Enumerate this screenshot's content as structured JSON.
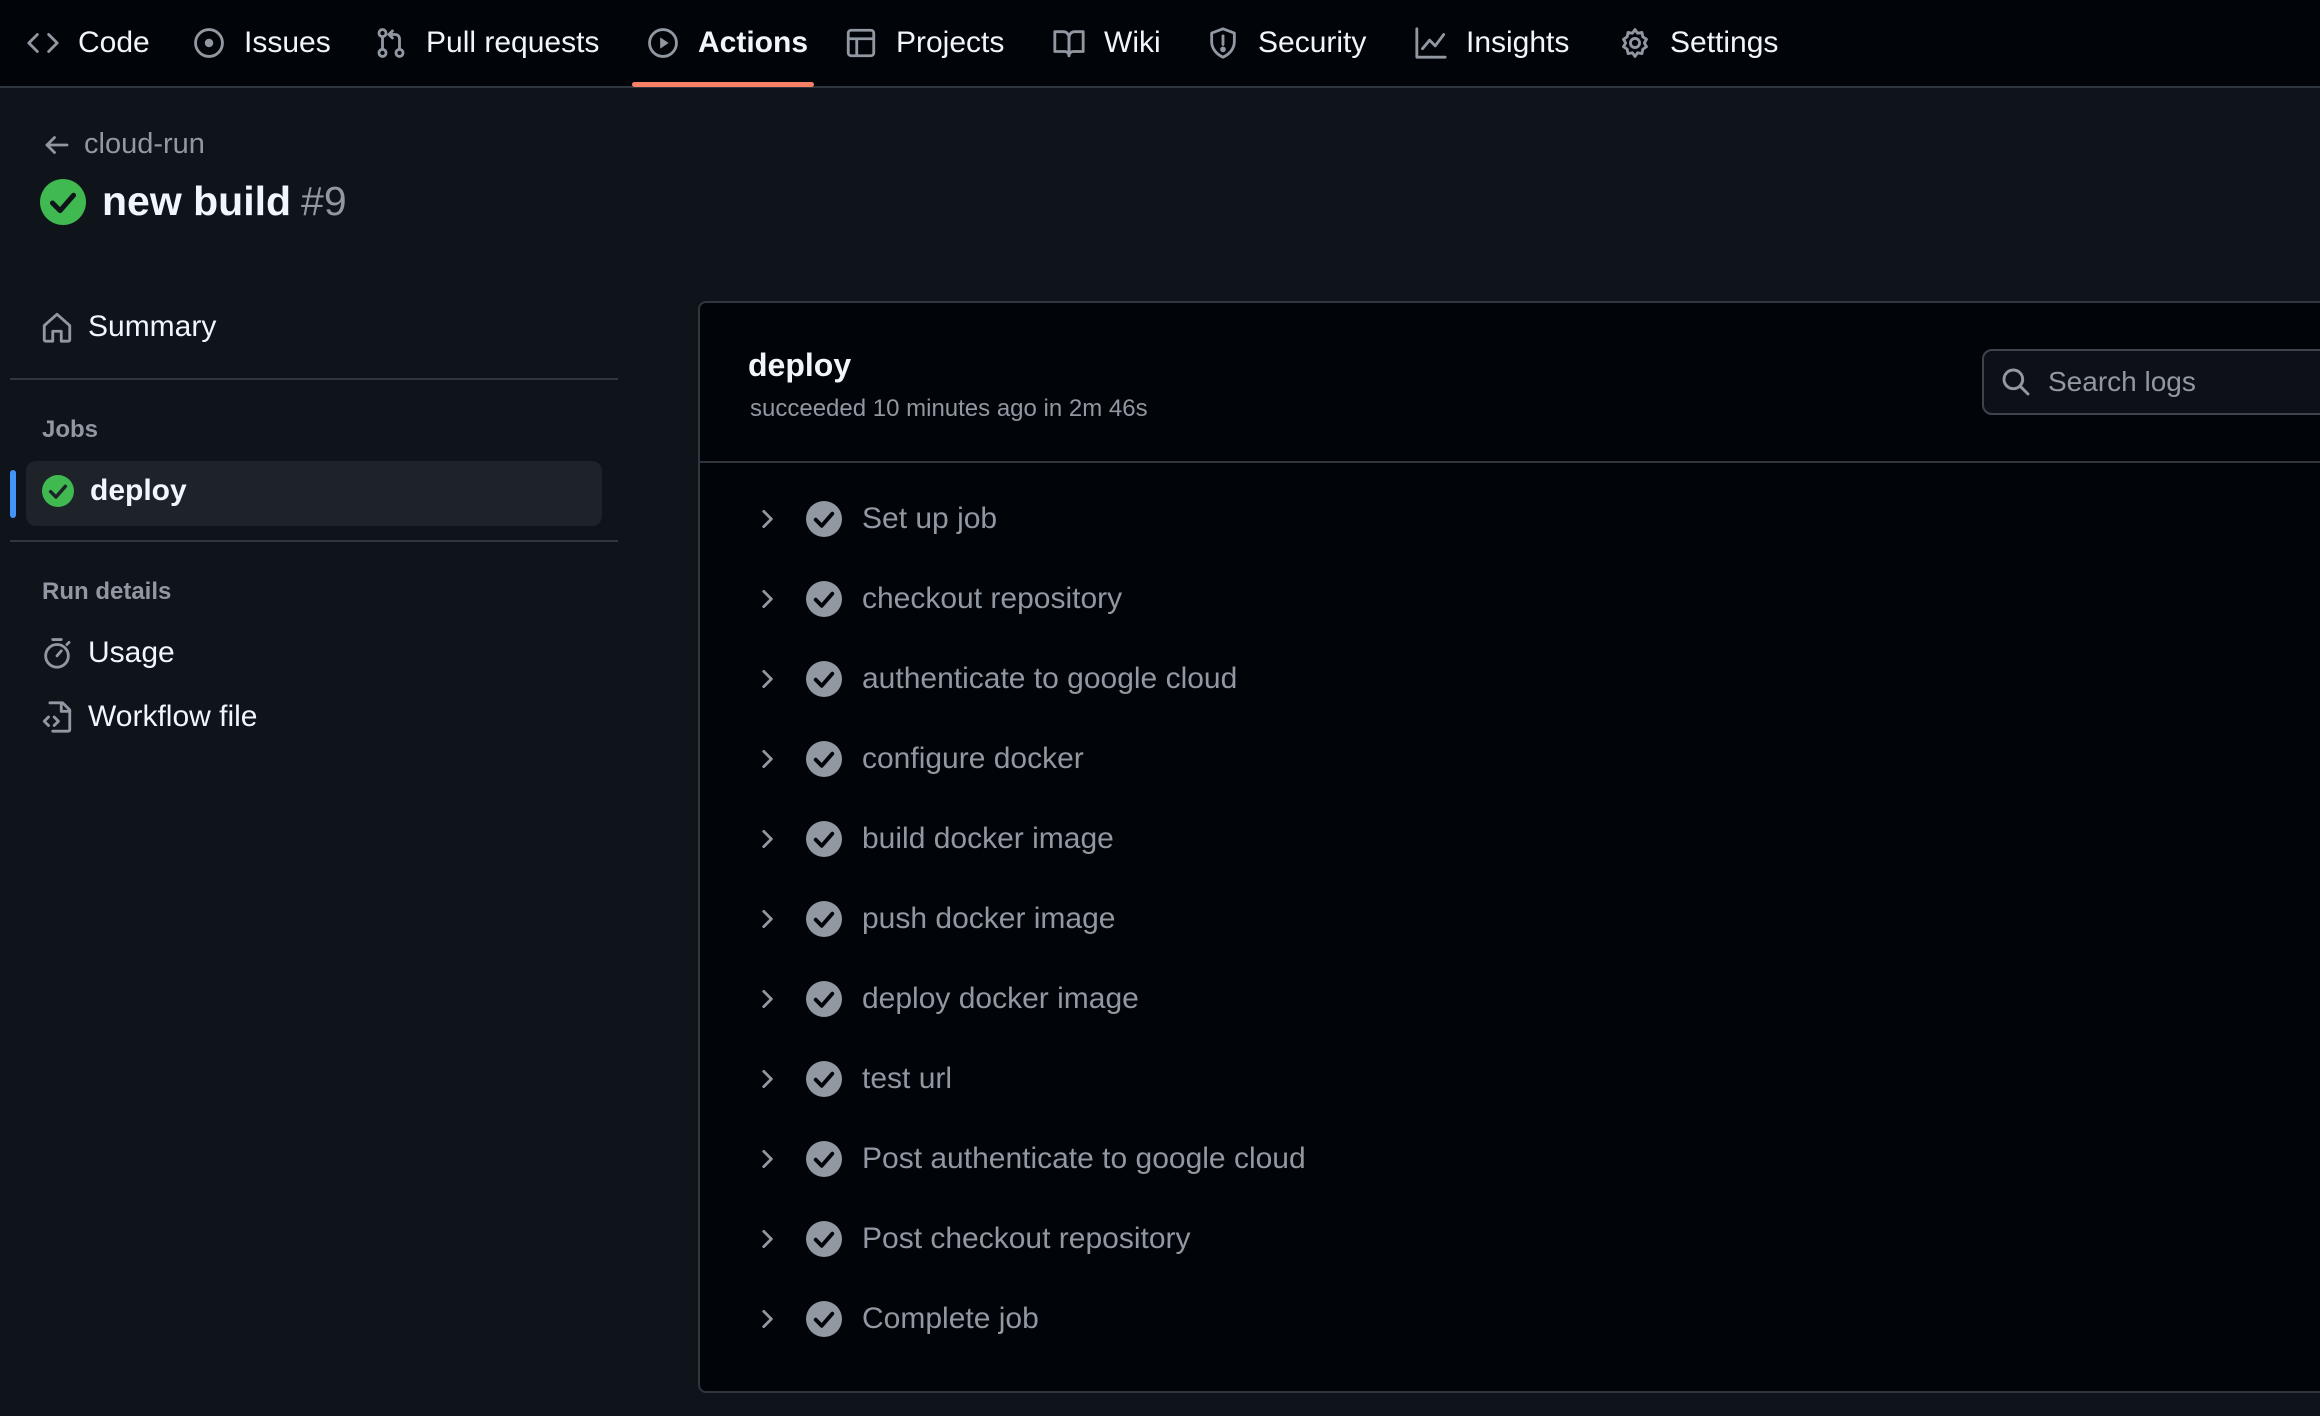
{
  "nav": {
    "items": [
      {
        "label": "Code",
        "icon": "code-icon"
      },
      {
        "label": "Issues",
        "icon": "issue-circle-icon"
      },
      {
        "label": "Pull requests",
        "icon": "pull-request-icon"
      },
      {
        "label": "Actions",
        "icon": "play-icon",
        "active": true
      },
      {
        "label": "Projects",
        "icon": "table-icon"
      },
      {
        "label": "Wiki",
        "icon": "book-icon"
      },
      {
        "label": "Security",
        "icon": "shield-icon"
      },
      {
        "label": "Insights",
        "icon": "graph-icon"
      },
      {
        "label": "Settings",
        "icon": "gear-icon"
      }
    ]
  },
  "header": {
    "back_label": "cloud-run",
    "run_title": "new build",
    "run_number": "#9"
  },
  "sidebar": {
    "summary_label": "Summary",
    "jobs_heading": "Jobs",
    "job_label": "deploy",
    "run_details_heading": "Run details",
    "usage_label": "Usage",
    "workflow_label": "Workflow file"
  },
  "job": {
    "title": "deploy",
    "status": "succeeded 10 minutes ago in 2m 46s",
    "search_placeholder": "Search logs",
    "steps": [
      "Set up job",
      "checkout repository",
      "authenticate to google cloud",
      "configure docker",
      "build docker image",
      "push docker image",
      "deploy docker image",
      "test url",
      "Post authenticate to google cloud",
      "Post checkout repository",
      "Complete job"
    ]
  },
  "colors": {
    "success_green": "#3fb950",
    "active_underline": "#f78166",
    "selected_accent": "#4493f8",
    "muted_text": "#9198a1"
  }
}
